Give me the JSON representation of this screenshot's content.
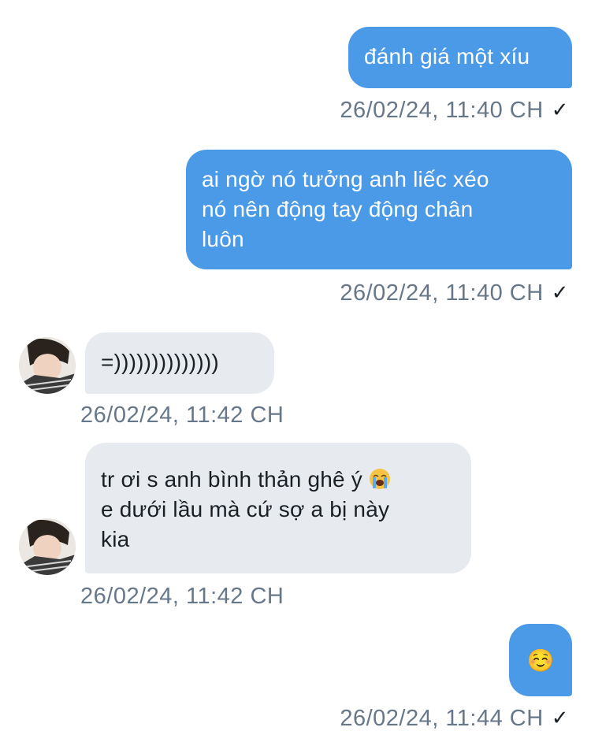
{
  "messages": [
    {
      "direction": "outgoing",
      "text": "đánh giá một xíu",
      "timestamp": "26/02/24, 11:40 CH",
      "status_icon": "checkmark-icon"
    },
    {
      "direction": "outgoing",
      "lines": [
        "ai ngờ nó tưởng anh liếc xéo",
        "nó nên động tay động chân",
        "luôn"
      ],
      "timestamp": "26/02/24, 11:40 CH",
      "status_icon": "checkmark-icon"
    },
    {
      "direction": "incoming",
      "text": "=))))))))))))))",
      "timestamp": "26/02/24, 11:42 CH"
    },
    {
      "direction": "incoming",
      "line1": "tr ơi s anh bình thản ghê ý",
      "line1_emoji": "loudly-crying-face-emoji",
      "lines_rest": [
        "e dưới lầu mà cứ sợ a bị này",
        "kia"
      ],
      "timestamp": "26/02/24, 11:42 CH"
    },
    {
      "direction": "outgoing",
      "emoji": "☺️",
      "timestamp": "26/02/24, 11:44 CH",
      "status_icon": "checkmark-icon"
    }
  ],
  "checkmark_glyph": "✓",
  "colors": {
    "outgoing_bubble": "#4a9ae7",
    "incoming_bubble": "#e7ebf0",
    "timestamp_text": "#66778a"
  }
}
